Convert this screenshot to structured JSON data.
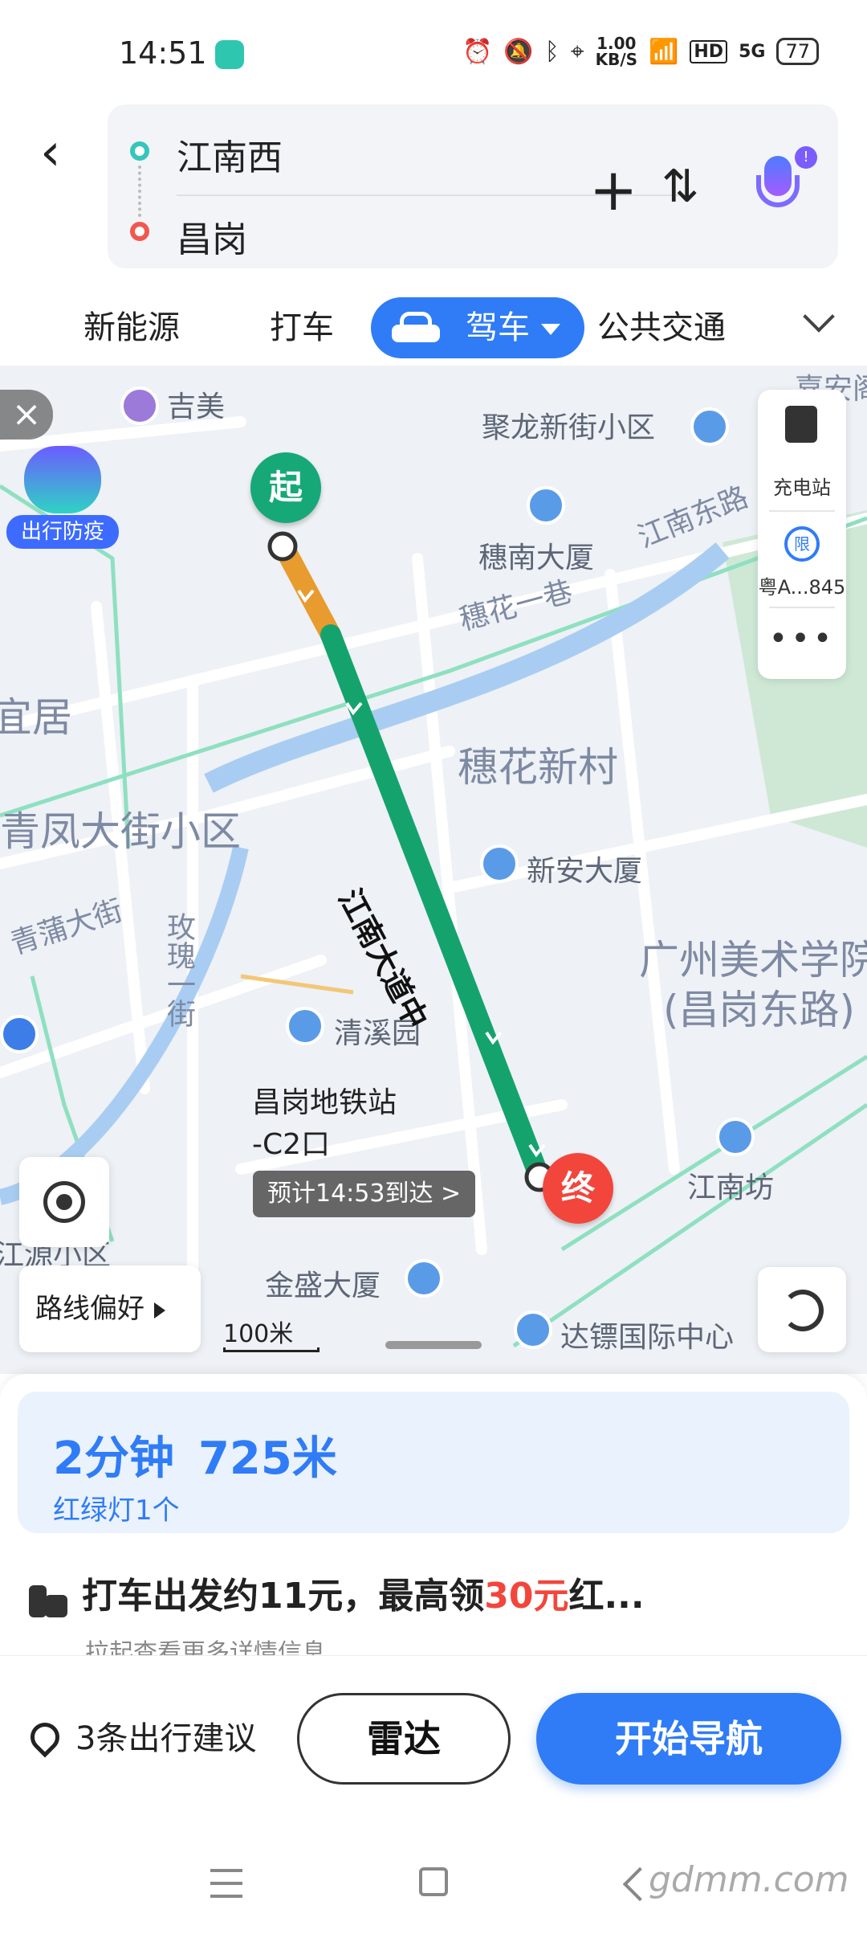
{
  "status": {
    "time": "14:51",
    "speed_value": "1.00",
    "speed_unit": "KB/S",
    "hd": "HD",
    "network": "5G",
    "battery": "77"
  },
  "route_search": {
    "from": "江南西",
    "to": "昌岗"
  },
  "tabs": [
    {
      "label": "新能源"
    },
    {
      "label": "打车"
    },
    {
      "label": "驾车",
      "active": true
    },
    {
      "label": "公共交通"
    }
  ],
  "map": {
    "epidemic_tag": "出行防疫",
    "right_panel": {
      "charging_label": "充电站",
      "limit_icon": "限",
      "plate_label": "粤A...845",
      "more": "•••"
    },
    "start_marker": "起",
    "end_marker": "终",
    "eta": "预计14:53到达 >",
    "route_pref": "路线偏好",
    "scale": "100米",
    "labels": {
      "jimei": "吉美",
      "julong": "聚龙新街小区",
      "suinan": "穗南大厦",
      "jiangnan_east": "江南东路",
      "suihua_lane": "穗花一巷",
      "yiju": "宜居",
      "suihua_village": "穗花新村",
      "qingfeng": "青凤大街小区",
      "xinan": "新安大厦",
      "qingpu": "青蒲大街",
      "meigui": "玫瑰一街",
      "academy1": "广州美术学院",
      "academy2": "(昌岗东路)",
      "qingxi": "清溪园",
      "road_main": "江南大道中",
      "metro1": "昌岗地铁站",
      "metro2": "-C2口",
      "jiangnanfang": "江南坊",
      "jiangyuan": "江源小区",
      "jinsheng": "金盛大厦",
      "dabiao": "达镖国际中心",
      "top_right": "嘉安阁"
    }
  },
  "route_summary": {
    "duration": "2分钟",
    "distance": "725米",
    "traffic_lights": "红绿灯1个"
  },
  "taxi_promo": {
    "text_prefix": "打车出发约11元，最高领",
    "highlight": "30元",
    "text_suffix": "红...",
    "hint": "拉起查看更多详情信息"
  },
  "actions": {
    "suggestions": "3条出行建议",
    "radar": "雷达",
    "start_nav": "开始导航"
  },
  "watermark": "gdmm.com",
  "colors": {
    "accent": "#2f7cf6",
    "start_green": "#17a878",
    "end_red": "#f2463c",
    "route_green": "#17a878",
    "route_yellow": "#f0a83a",
    "highlight_red": "#f2463c"
  }
}
